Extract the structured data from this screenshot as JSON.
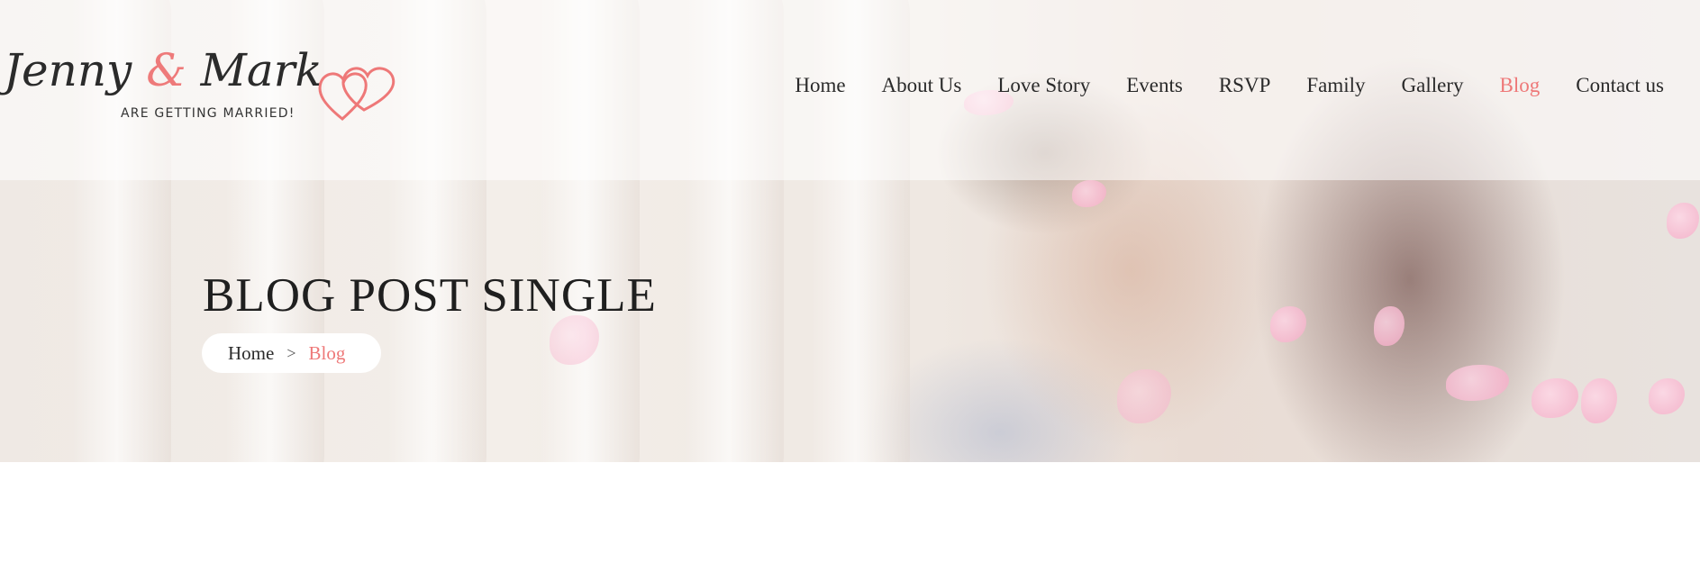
{
  "header": {
    "logo": {
      "name_first": "Jenny",
      "ampersand": "&",
      "name_second": "Mark",
      "tagline": "ARE GETTING MARRIED!"
    },
    "nav": [
      {
        "label": "Home",
        "active": false
      },
      {
        "label": "About Us",
        "active": false
      },
      {
        "label": "Love Story",
        "active": false
      },
      {
        "label": "Events",
        "active": false
      },
      {
        "label": "RSVP",
        "active": false
      },
      {
        "label": "Family",
        "active": false
      },
      {
        "label": "Gallery",
        "active": false
      },
      {
        "label": "Blog",
        "active": true
      },
      {
        "label": "Contact us",
        "active": false
      }
    ]
  },
  "hero": {
    "title": "BLOG POST SINGLE",
    "breadcrumb": {
      "home": "Home",
      "separator": ">",
      "current": "Blog"
    }
  },
  "colors": {
    "accent": "#ee7878",
    "text": "#222222"
  }
}
